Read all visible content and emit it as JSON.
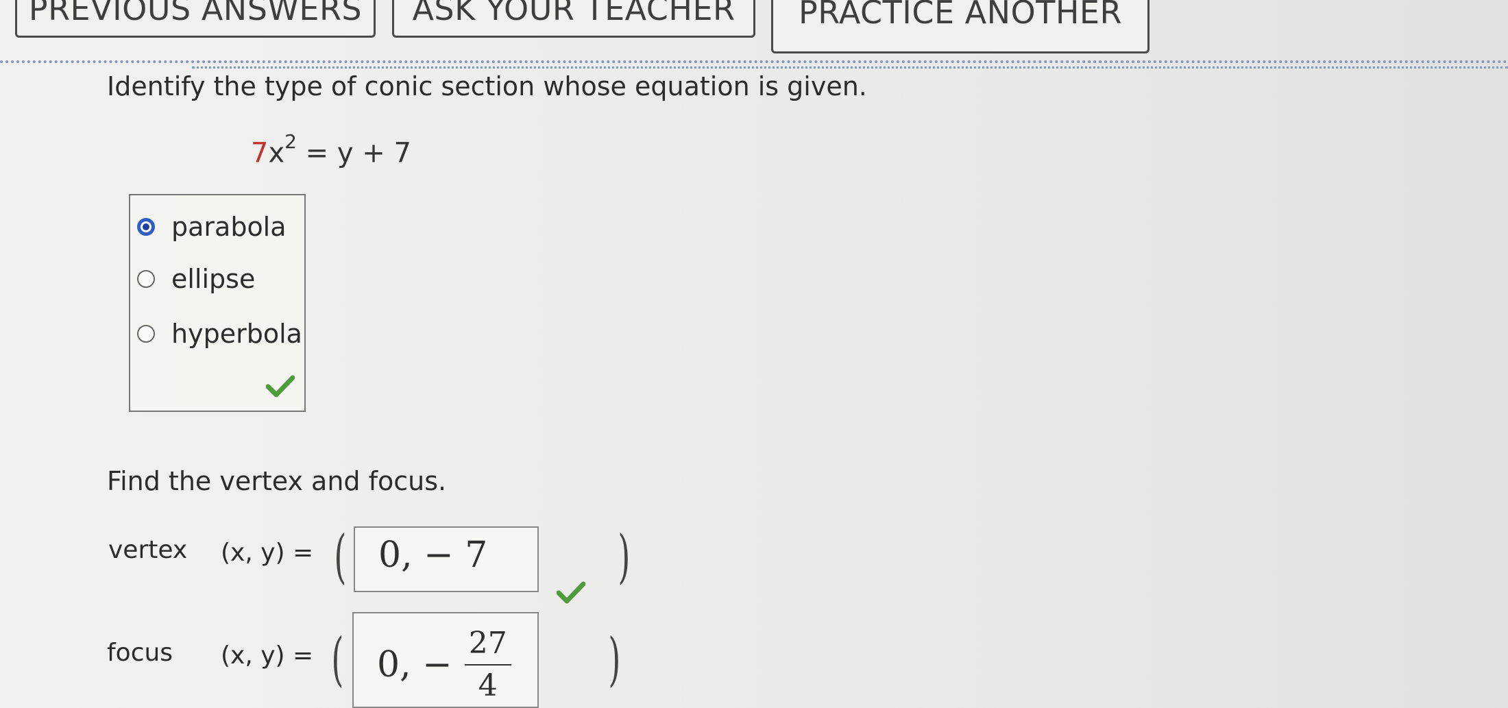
{
  "top_buttons": {
    "previous_answers": "PREVIOUS ANSWERS",
    "ask_your_teacher": "ASK YOUR TEACHER",
    "practice_another": "PRACTICE ANOTHER"
  },
  "question1": {
    "prompt": "Identify the type of conic section whose equation is given.",
    "equation": {
      "coef": "7",
      "var": "x",
      "exp": "2",
      "rest": " = y + 7"
    },
    "choices": [
      {
        "label": "parabola",
        "selected": true
      },
      {
        "label": "ellipse",
        "selected": false
      },
      {
        "label": "hyperbola",
        "selected": false
      }
    ],
    "status": "correct"
  },
  "question2": {
    "prompt": "Find the vertex and focus.",
    "vertex": {
      "label": "vertex",
      "xy": "(x, y) =",
      "answer": "0, − 7",
      "status": "correct"
    },
    "focus": {
      "label": "focus",
      "xy": "(x, y) =",
      "answer_prefix": "0, −",
      "fraction_num": "27",
      "fraction_den": "4"
    }
  },
  "colors": {
    "accent_blue": "#2f5fc4",
    "check_green": "#4f9a3a",
    "coef_red": "#c0322c",
    "separator": "#7f98c6"
  }
}
